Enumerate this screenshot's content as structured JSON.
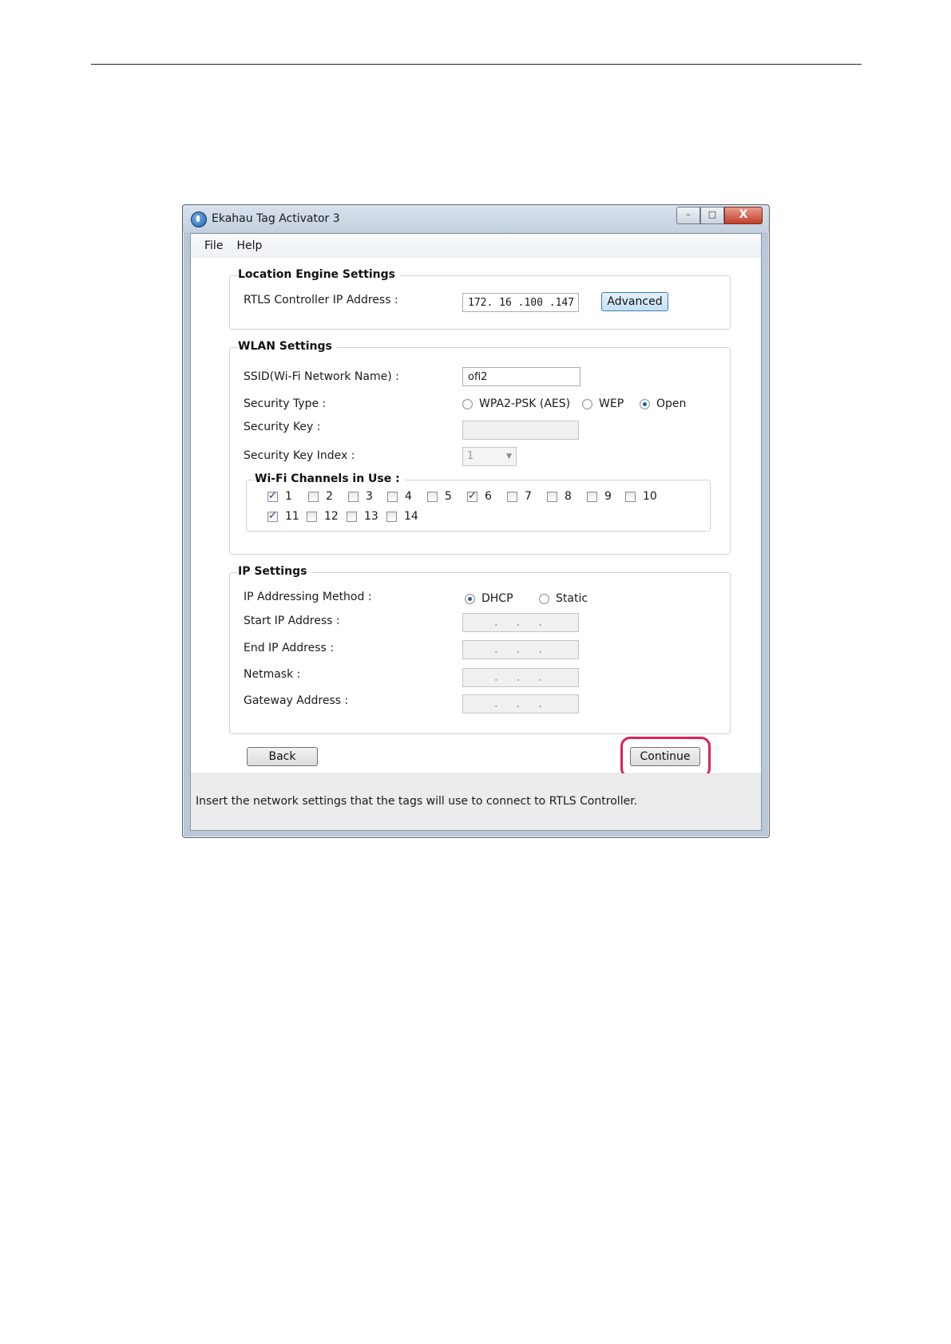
{
  "window": {
    "title": "Ekahau Tag  Activator 3",
    "controls": {
      "minimize": "–",
      "maximize": "□",
      "close": "X"
    }
  },
  "menu": [
    "File",
    "Help"
  ],
  "location_engine": {
    "title": "Location Engine Settings",
    "ip_label": "RTLS Controller IP Address :",
    "ip_value": "172. 16 .100 .147",
    "advanced_button": "Advanced"
  },
  "wlan": {
    "title": "WLAN Settings",
    "ssid_label": "SSID(Wi-Fi Network Name) :",
    "ssid_value": "ofi2",
    "security_type_label": "Security Type :",
    "security_options": [
      {
        "label": "WPA2-PSK (AES)",
        "selected": false
      },
      {
        "label": "WEP",
        "selected": false
      },
      {
        "label": "Open",
        "selected": true
      }
    ],
    "security_key_label": "Security Key :",
    "security_key_value": "",
    "key_index_label": "Security Key Index :",
    "key_index_value": "1",
    "channels_title": "Wi-Fi Channels in Use :",
    "channels": [
      {
        "label": "1",
        "checked": true
      },
      {
        "label": "2",
        "checked": false
      },
      {
        "label": "3",
        "checked": false
      },
      {
        "label": "4",
        "checked": false
      },
      {
        "label": "5",
        "checked": false
      },
      {
        "label": "6",
        "checked": true
      },
      {
        "label": "7",
        "checked": false
      },
      {
        "label": "8",
        "checked": false
      },
      {
        "label": "9",
        "checked": false
      },
      {
        "label": "10",
        "checked": false
      },
      {
        "label": "11",
        "checked": true
      },
      {
        "label": "12",
        "checked": false
      },
      {
        "label": "13",
        "checked": false
      },
      {
        "label": "14",
        "checked": false
      }
    ]
  },
  "ip": {
    "title": "IP Settings",
    "method_label": "IP Addressing Method :",
    "methods": [
      {
        "label": "DHCP",
        "selected": true
      },
      {
        "label": "Static",
        "selected": false
      }
    ],
    "start_label": "Start IP Address :",
    "end_label": "End IP Address :",
    "netmask_label": "Netmask :",
    "gateway_label": "Gateway Address :",
    "empty_ip": ".  .  ."
  },
  "buttons": {
    "back": "Back",
    "continue": "Continue"
  },
  "status": "Insert the network settings that the tags will use to connect to RTLS Controller.",
  "colors": {
    "highlight": "#e0205a",
    "radio_dot": "#1e5ea3"
  }
}
